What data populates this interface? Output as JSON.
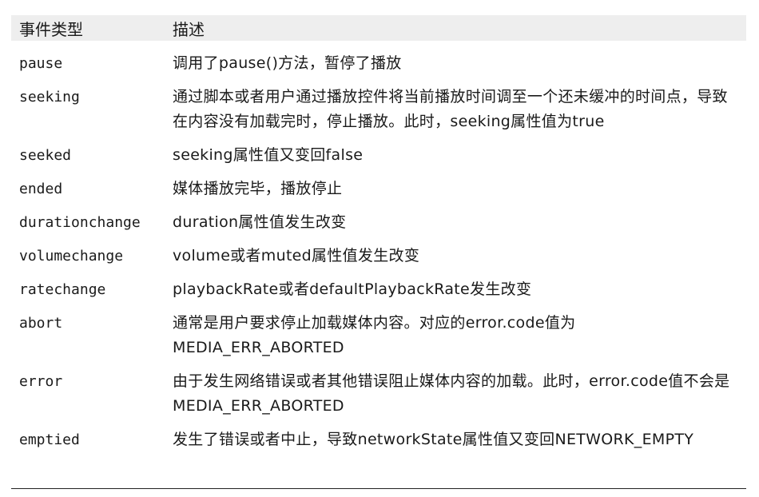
{
  "table": {
    "headers": {
      "event_type": "事件类型",
      "description": "描述"
    },
    "rows": [
      {
        "event": "pause",
        "desc": "调用了pause()方法，暂停了播放"
      },
      {
        "event": "seeking",
        "desc": "通过脚本或者用户通过播放控件将当前播放时间调至一个还未缓冲的时间点，导致在内容没有加载完时，停止播放。此时，seeking属性值为true"
      },
      {
        "event": "seeked",
        "desc": "seeking属性值又变回false"
      },
      {
        "event": "ended",
        "desc": "媒体播放完毕，播放停止"
      },
      {
        "event": "durationchange",
        "desc": "duration属性值发生改变"
      },
      {
        "event": "volumechange",
        "desc": "volume或者muted属性值发生改变"
      },
      {
        "event": "ratechange",
        "desc": "playbackRate或者defaultPlaybackRate发生改变"
      },
      {
        "event": "abort",
        "desc": "通常是用户要求停止加载媒体内容。对应的error.code值为MEDIA_ERR_ABORTED"
      },
      {
        "event": "error",
        "desc": "由于发生网络错误或者其他错误阻止媒体内容的加载。此时，error.code值不会是MEDIA_ERR_ABORTED"
      },
      {
        "event": "emptied",
        "desc": "发生了错误或者中止，导致networkState属性值又变回NETWORK_EMPTY"
      }
    ]
  }
}
